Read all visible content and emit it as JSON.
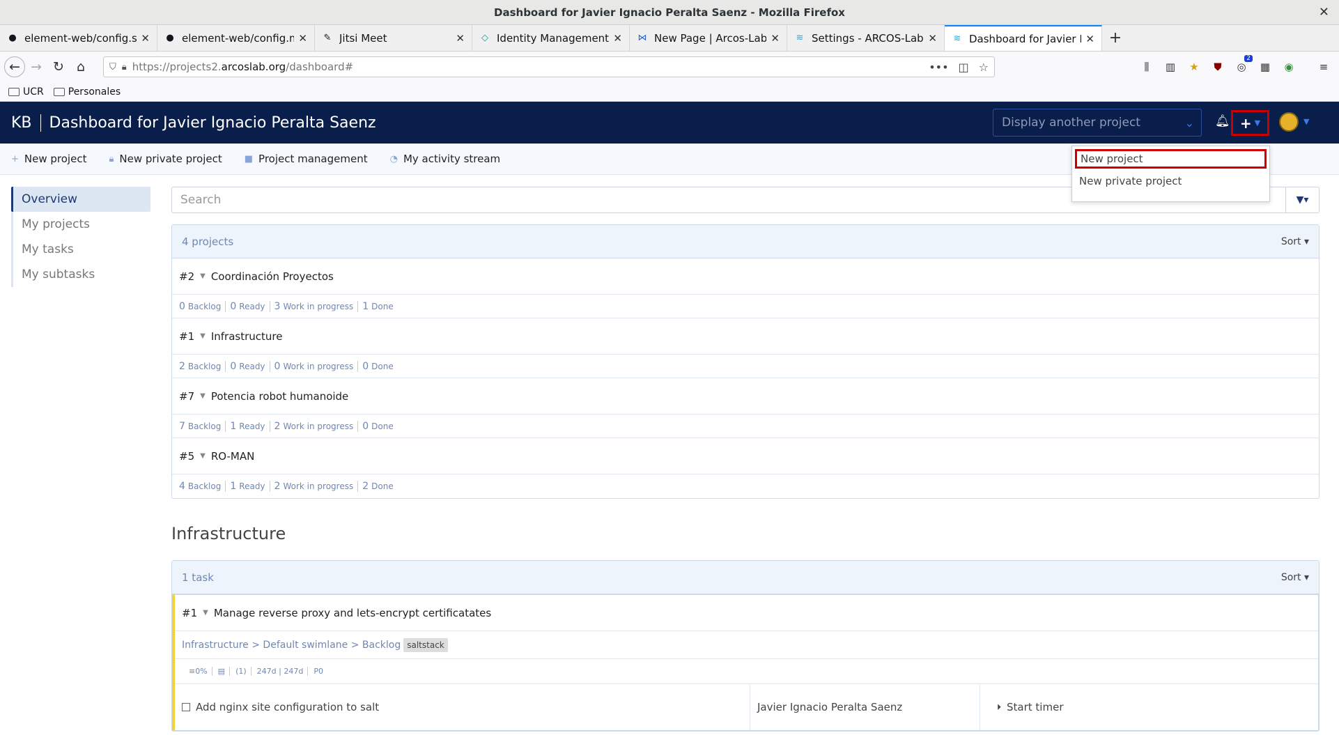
{
  "window": {
    "title": "Dashboard for Javier Ignacio Peralta Saenz - Mozilla Firefox"
  },
  "tabs": [
    {
      "label": "element-web/config.sam",
      "icon": "github-icon"
    },
    {
      "label": "element-web/config.md",
      "icon": "github-icon"
    },
    {
      "label": "Jitsi Meet",
      "icon": "jitsi-icon"
    },
    {
      "label": "Identity Management",
      "icon": "keycloak-icon"
    },
    {
      "label": "New Page | Arcos-Lab Wi",
      "icon": "wiki-icon"
    },
    {
      "label": "Settings - ARCOS-Lab Ne",
      "icon": "nextcloud-icon"
    },
    {
      "label": "Dashboard for Javier Igna",
      "icon": "kanboard-icon",
      "active": true
    }
  ],
  "address": {
    "prefix": "https://projects2.",
    "domain": "arcoslab.org",
    "path": "/dashboard#"
  },
  "bookmarks": [
    "UCR",
    "Personales"
  ],
  "app": {
    "brand": "KB",
    "title": "Dashboard for Javier Ignacio Peralta Saenz",
    "project_select_placeholder": "Display another project"
  },
  "subnav": [
    "New project",
    "New private project",
    "Project management",
    "My activity stream"
  ],
  "dropdown": [
    "New project",
    "New private project"
  ],
  "sidebar": [
    "Overview",
    "My projects",
    "My tasks",
    "My subtasks"
  ],
  "search": {
    "placeholder": "Search"
  },
  "projects_panel": {
    "count_label": "4 projects",
    "sort_label": "Sort",
    "projects": [
      {
        "num": "#2",
        "name": "Coordinación Proyectos",
        "stats": [
          {
            "n": "0",
            "l": "Backlog"
          },
          {
            "n": "0",
            "l": "Ready"
          },
          {
            "n": "3",
            "l": "Work in progress"
          },
          {
            "n": "1",
            "l": "Done"
          }
        ]
      },
      {
        "num": "#1",
        "name": "Infrastructure",
        "stats": [
          {
            "n": "2",
            "l": "Backlog"
          },
          {
            "n": "0",
            "l": "Ready"
          },
          {
            "n": "0",
            "l": "Work in progress"
          },
          {
            "n": "0",
            "l": "Done"
          }
        ]
      },
      {
        "num": "#7",
        "name": "Potencia robot humanoide",
        "stats": [
          {
            "n": "7",
            "l": "Backlog"
          },
          {
            "n": "1",
            "l": "Ready"
          },
          {
            "n": "2",
            "l": "Work in progress"
          },
          {
            "n": "0",
            "l": "Done"
          }
        ]
      },
      {
        "num": "#5",
        "name": "RO-MAN",
        "stats": [
          {
            "n": "4",
            "l": "Backlog"
          },
          {
            "n": "1",
            "l": "Ready"
          },
          {
            "n": "2",
            "l": "Work in progress"
          },
          {
            "n": "2",
            "l": "Done"
          }
        ]
      }
    ]
  },
  "infra_section": {
    "title": "Infrastructure",
    "count_label": "1 task",
    "sort_label": "Sort",
    "task": {
      "num": "#1",
      "title": "Manage reverse proxy and lets-encrypt certificatates",
      "path": "Infrastructure > Default swimlane > Backlog",
      "tag": "saltstack",
      "meta": [
        "0%",
        "(1)",
        "247d",
        "247d",
        "P0"
      ],
      "subtask": {
        "title": "Add nginx site configuration to salt",
        "assignee": "Javier Ignacio Peralta Saenz",
        "timer": "Start timer"
      }
    }
  },
  "colors": {
    "header_bg": "#0a1e4b",
    "highlight": "#cc0000",
    "accent": "#3a78f2"
  }
}
